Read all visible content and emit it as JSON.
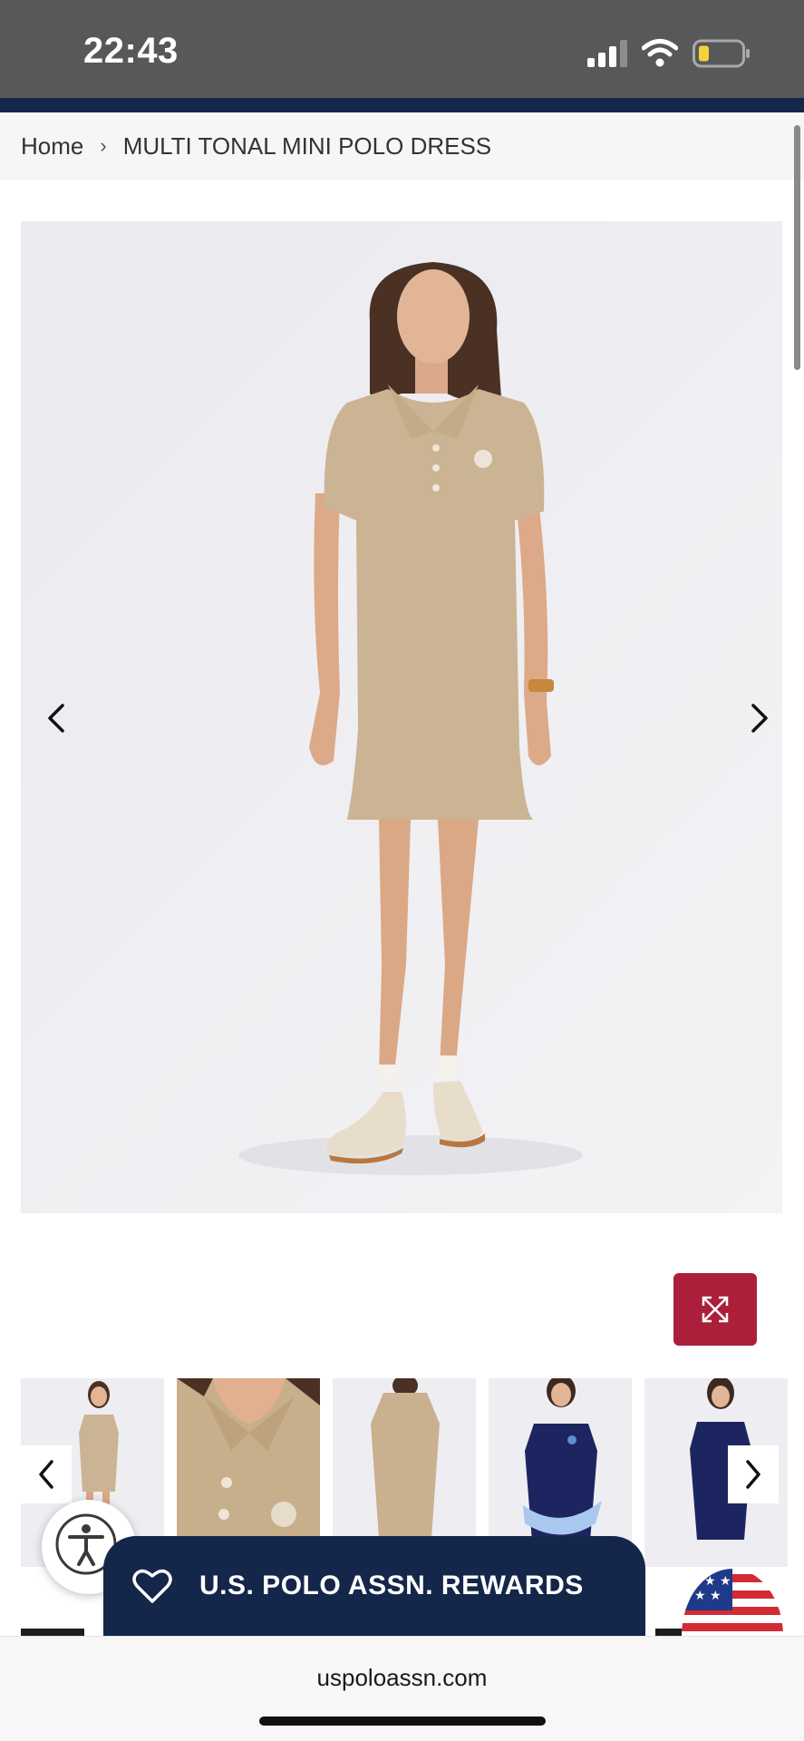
{
  "status_bar": {
    "time": "22:43",
    "icons": [
      "cellular-signal-icon",
      "wifi-icon",
      "battery-low-icon"
    ],
    "background": "#58585a"
  },
  "breadcrumb": {
    "home_label": "Home",
    "separator": "›",
    "current_label": "MULTI TONAL MINI POLO DRESS"
  },
  "product_gallery": {
    "main_image_alt": "Model wearing khaki polo dress",
    "prev_icon": "chevron-left-icon",
    "next_icon": "chevron-right-icon",
    "expand_icon": "expand-arrows-icon",
    "thumbnails": [
      {
        "alt": "Front view khaki dress"
      },
      {
        "alt": "Collar detail"
      },
      {
        "alt": "Back view khaki dress"
      },
      {
        "alt": "Navy polo with tied sweater"
      },
      {
        "alt": "Navy polo dress"
      }
    ]
  },
  "accessibility": {
    "icon": "accessibility-icon",
    "close_icon": "close-badge-icon"
  },
  "rewards": {
    "icon": "heart-icon",
    "label": "U.S. POLO ASSN. REWARDS"
  },
  "country_selector": {
    "icon": "us-flag-icon"
  },
  "browser": {
    "url": "uspoloassn.com"
  },
  "colors": {
    "navy": "#14274a",
    "accent_red": "#ab1f3b",
    "dress_khaki": "#cbb493"
  }
}
